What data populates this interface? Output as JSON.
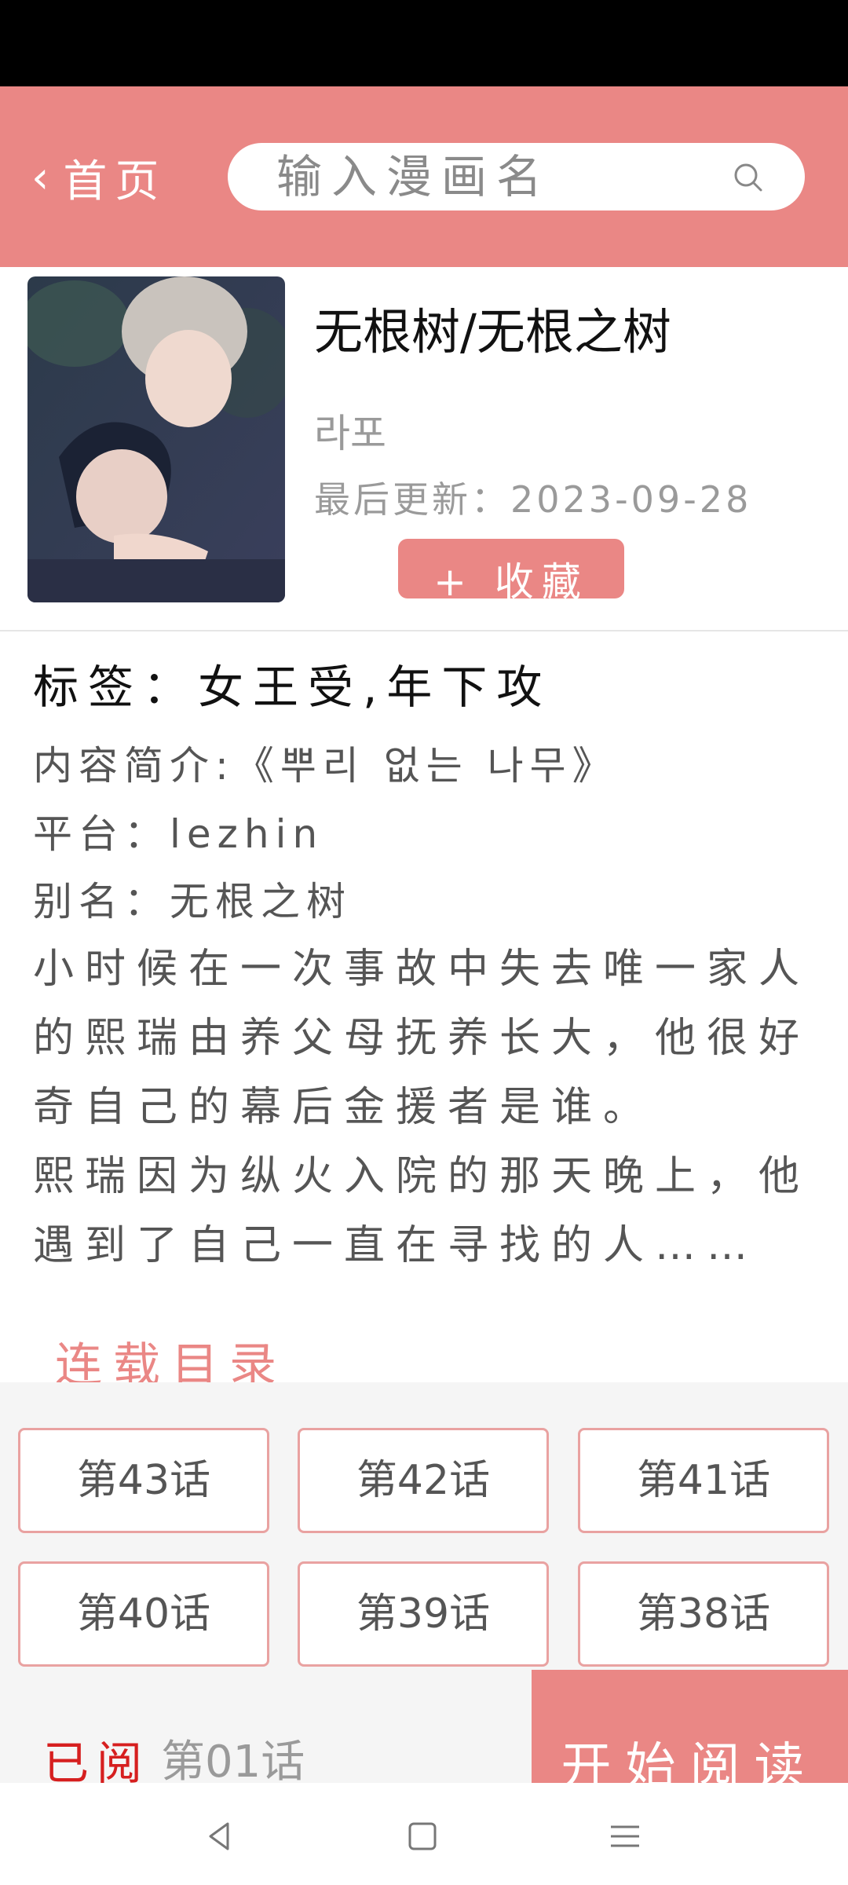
{
  "header": {
    "back_label": "首页",
    "search_placeholder": "输入漫画名"
  },
  "comic": {
    "title": "无根树/无根之树",
    "author": "라포",
    "updated": "最后更新：2023-09-28",
    "favorite_label": "+ 收藏"
  },
  "details": {
    "tags": "标签：女王受,年下攻",
    "intro": "内容简介:《뿌리 없는 나무》",
    "platform": "平台：lezhin",
    "alias": "别名：无根之树",
    "description_1": "小时候在一次事故中失去唯一家人的熙瑞由养父母抚养长大，他很好奇自己的幕后金援者是谁。",
    "description_2": "熙瑞因为纵火入院的那天晚上，他遇到了自己一直在寻找的人……"
  },
  "toc": {
    "title": "连载目录",
    "chapters": [
      "第43话",
      "第42话",
      "第41话",
      "第40话",
      "第39话",
      "第38话"
    ]
  },
  "footer": {
    "read_label": "已阅",
    "read_chapter": "第01话",
    "start_label": "开始阅读"
  },
  "icons": {
    "back": "chevron-left-icon",
    "search": "search-icon",
    "nav_back": "triangle-back-icon",
    "nav_home": "square-home-icon",
    "nav_menu": "menu-icon"
  },
  "colors": {
    "accent": "#ea8785",
    "read_red": "#d61f1f"
  }
}
